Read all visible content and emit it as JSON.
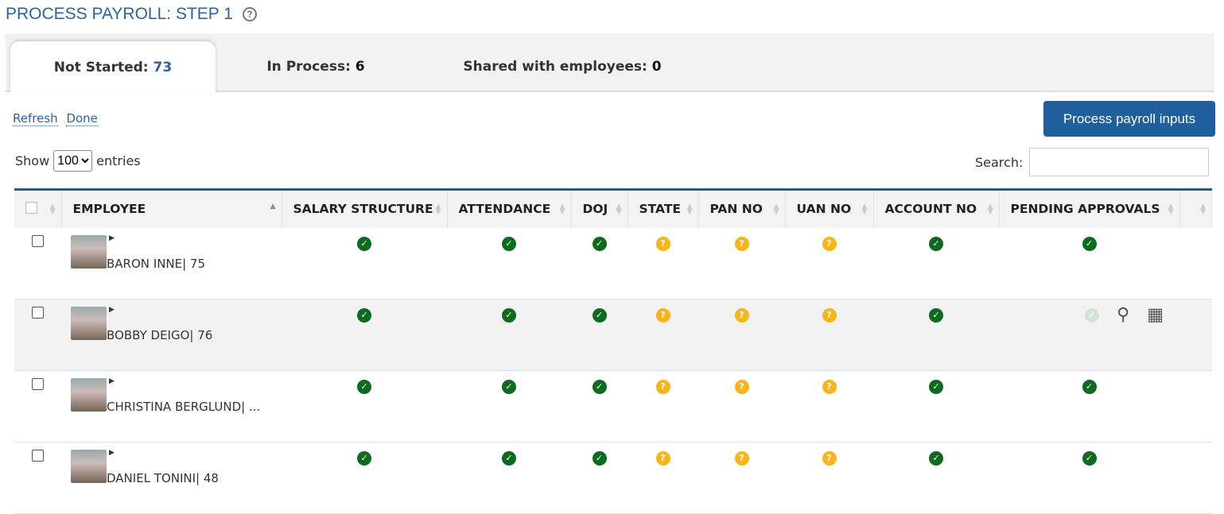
{
  "title": "PROCESS PAYROLL: STEP 1",
  "tabs": [
    {
      "label": "Not Started:",
      "count": "73"
    },
    {
      "label": "In Process:",
      "count": "6"
    },
    {
      "label": "Shared with employees:",
      "count": "0"
    }
  ],
  "links": {
    "refresh": "Refresh",
    "done": "Done"
  },
  "process_button": "Process payroll inputs",
  "show": {
    "label": "Show",
    "value": "100",
    "suffix": "entries"
  },
  "search": {
    "label": "Search:",
    "value": ""
  },
  "columns": [
    "EMPLOYEE",
    "SALARY STRUCTURE",
    "ATTENDANCE",
    "DOJ",
    "STATE",
    "PAN NO",
    "UAN NO",
    "ACCOUNT NO",
    "PENDING APPROVALS"
  ],
  "colors": {
    "ok": "#0c6b1e",
    "pending": "#f7b518",
    "accent": "#2a63a3"
  },
  "rows": [
    {
      "name": "BARON INNE| 75",
      "status": [
        "ok",
        "ok",
        "ok",
        "q",
        "q",
        "q",
        "ok",
        "ok"
      ]
    },
    {
      "name": "BOBBY DEIGO| 76",
      "status": [
        "ok",
        "ok",
        "ok",
        "q",
        "q",
        "q",
        "ok",
        "fade"
      ],
      "actions": [
        "binoculars-icon",
        "calendar-icon"
      ]
    },
    {
      "name": "CHRISTINA BERGLUND| ...",
      "status": [
        "ok",
        "ok",
        "ok",
        "q",
        "q",
        "q",
        "ok",
        "ok"
      ]
    },
    {
      "name": "DANIEL TONINI| 48",
      "status": [
        "ok",
        "ok",
        "ok",
        "q",
        "q",
        "q",
        "ok",
        "ok"
      ]
    }
  ]
}
